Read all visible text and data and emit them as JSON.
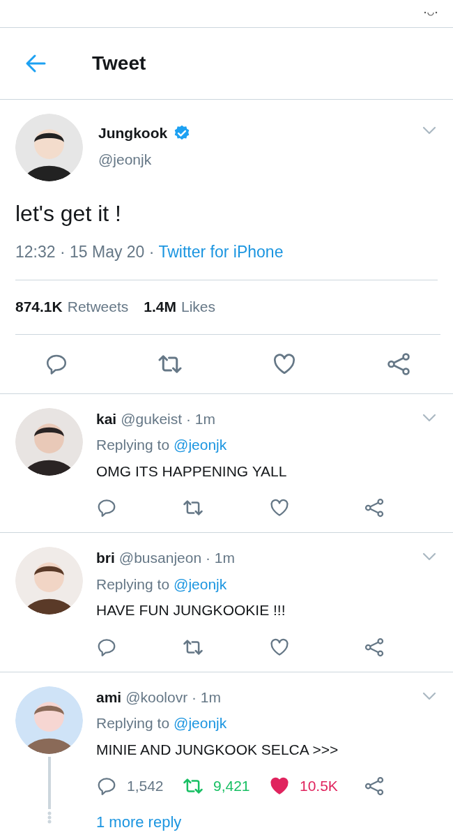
{
  "header": {
    "title": "Tweet"
  },
  "tweet": {
    "name": "Jungkook",
    "verified": true,
    "handle": "@jeonjk",
    "text": "let's get it !",
    "time": "12:32 · 15 May 20 ·",
    "source": "Twitter for iPhone",
    "retweets_count": "874.1K",
    "retweets_label": "Retweets",
    "likes_count": "1.4M",
    "likes_label": "Likes"
  },
  "replies": [
    {
      "name": "kai",
      "handle": "@gukeist · 1m",
      "replying_label": "Replying to",
      "replying_to": "@jeonjk",
      "text": "OMG ITS HAPPENING YALL",
      "retweeted": false,
      "liked": false,
      "thread": false
    },
    {
      "name": "bri",
      "handle": "@busanjeon · 1m",
      "replying_label": "Replying to",
      "replying_to": "@jeonjk",
      "text": "HAVE FUN JUNGKOOKIE !!!",
      "retweeted": false,
      "liked": false,
      "thread": false
    },
    {
      "name": "ami",
      "handle": "@koolovr · 1m",
      "replying_label": "Replying to",
      "replying_to": "@jeonjk",
      "text": "MINIE AND JUNGKOOK SELCA >>>",
      "reply_count": "1,542",
      "retweet_count": "9,421",
      "like_count": "10.5K",
      "retweeted": true,
      "liked": true,
      "thread": true,
      "more_replies": "1 more reply"
    }
  ]
}
